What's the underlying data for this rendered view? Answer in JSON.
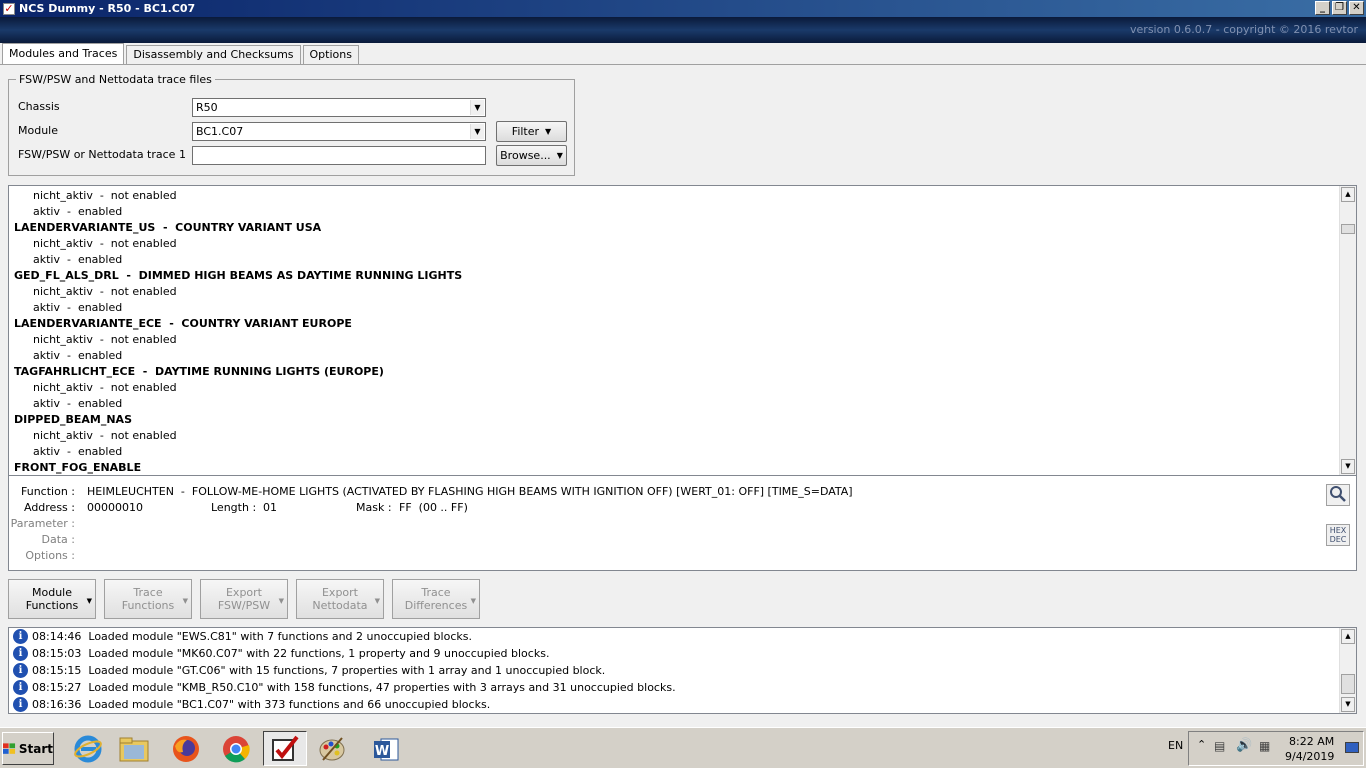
{
  "window": {
    "title": "NCS Dummy - R50 - BC1.C07",
    "version": "version 0.6.0.7 - copyright © 2016 revtor"
  },
  "tabs": [
    "Modules and Traces",
    "Disassembly and Checksums",
    "Options"
  ],
  "group": {
    "legend": "FSW/PSW and Nettodata trace files",
    "chassis_label": "Chassis",
    "chassis_value": "R50",
    "module_label": "Module",
    "module_value": "BC1.C07",
    "trace_label": "FSW/PSW or Nettodata trace 1",
    "trace_value": "",
    "filter_label": "Filter",
    "browse_label": "Browse..."
  },
  "list": [
    {
      "text": "nicht_aktiv  -  not enabled",
      "kind": "sub"
    },
    {
      "text": "aktiv  -  enabled",
      "kind": "sub"
    },
    {
      "text": "LAENDERVARIANTE_US  -  COUNTRY VARIANT USA",
      "kind": "hdr"
    },
    {
      "text": "nicht_aktiv  -  not enabled",
      "kind": "sub"
    },
    {
      "text": "aktiv  -  enabled",
      "kind": "sub"
    },
    {
      "text": "GED_FL_ALS_DRL  -  DIMMED HIGH BEAMS AS DAYTIME RUNNING LIGHTS",
      "kind": "hdr"
    },
    {
      "text": "nicht_aktiv  -  not enabled",
      "kind": "sub"
    },
    {
      "text": "aktiv  -  enabled",
      "kind": "sub"
    },
    {
      "text": "LAENDERVARIANTE_ECE  -  COUNTRY VARIANT EUROPE",
      "kind": "hdr"
    },
    {
      "text": "nicht_aktiv  -  not enabled",
      "kind": "sub"
    },
    {
      "text": "aktiv  -  enabled",
      "kind": "sub"
    },
    {
      "text": "TAGFAHRLICHT_ECE  -  DAYTIME RUNNING LIGHTS (EUROPE)",
      "kind": "hdr"
    },
    {
      "text": "nicht_aktiv  -  not enabled",
      "kind": "sub"
    },
    {
      "text": "aktiv  -  enabled",
      "kind": "sub"
    },
    {
      "text": "DIPPED_BEAM_NAS",
      "kind": "hdr"
    },
    {
      "text": "nicht_aktiv  -  not enabled",
      "kind": "sub"
    },
    {
      "text": "aktiv  -  enabled",
      "kind": "sub"
    },
    {
      "text": "FRONT_FOG_ENABLE",
      "kind": "hdr"
    }
  ],
  "detail": {
    "function_label": "Function :",
    "function_value": "HEIMLEUCHTEN  -  FOLLOW-ME-HOME LIGHTS (ACTIVATED BY FLASHING HIGH BEAMS WITH IGNITION OFF) [WERT_01: OFF] [TIME_S=DATA]",
    "address_label": "Address :",
    "address_value": "00000010",
    "length_label": "Length :",
    "length_value": "01",
    "mask_label": "Mask :",
    "mask_value": "FF  (00 .. FF)",
    "parameter_label": "Parameter :",
    "data_label": "Data :",
    "options_label": "Options :",
    "hexdec_top": "HEX",
    "hexdec_bottom": "DEC"
  },
  "actions": [
    {
      "line1": "Module",
      "line2": "Functions",
      "enabled": true
    },
    {
      "line1": "Trace",
      "line2": "Functions",
      "enabled": false
    },
    {
      "line1": "Export",
      "line2": "FSW/PSW",
      "enabled": false
    },
    {
      "line1": "Export",
      "line2": "Nettodata",
      "enabled": false
    },
    {
      "line1": "Trace",
      "line2": "Differences",
      "enabled": false
    }
  ],
  "log": [
    "08:14:46  Loaded module \"EWS.C81\" with 7 functions and 2 unoccupied blocks.",
    "08:15:03  Loaded module \"MK60.C07\" with 22 functions, 1 property and 9 unoccupied blocks.",
    "08:15:15  Loaded module \"GT.C06\" with 15 functions, 7 properties with 1 array and 1 unoccupied block.",
    "08:15:27  Loaded module \"KMB_R50.C10\" with 158 functions, 47 properties with 3 arrays and 31 unoccupied blocks.",
    "08:16:36  Loaded module \"BC1.C07\" with 373 functions and 66 unoccupied blocks."
  ],
  "taskbar": {
    "start_label": "Start",
    "lang": "EN",
    "time": "8:22 AM",
    "date": "9/4/2019"
  }
}
